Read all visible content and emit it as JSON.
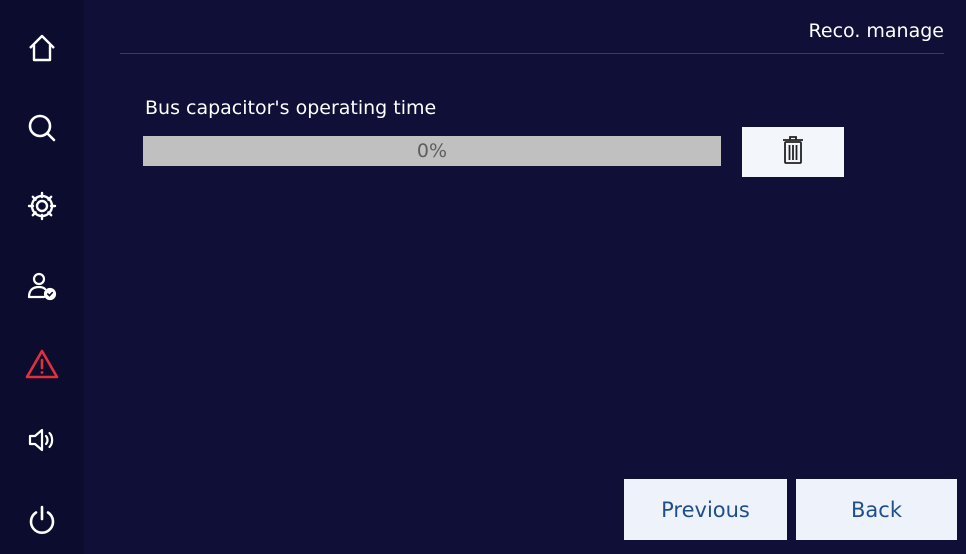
{
  "header": {
    "title": "Reco. manage"
  },
  "sidebar": {
    "items": [
      {
        "icon": "home-icon"
      },
      {
        "icon": "search-icon"
      },
      {
        "icon": "gear-icon"
      },
      {
        "icon": "user-check-icon"
      },
      {
        "icon": "warning-icon",
        "color": "#e0303c"
      },
      {
        "icon": "speaker-icon"
      },
      {
        "icon": "power-icon"
      }
    ]
  },
  "main": {
    "parameter": {
      "label": "Bus capacitor's operating time",
      "progress_text": "0%",
      "progress_value": 0,
      "delete_icon": "trash-icon"
    }
  },
  "footer": {
    "previous_label": "Previous",
    "back_label": "Back"
  },
  "colors": {
    "background": "#0f0f37",
    "accent": "#1f4f8a",
    "alert": "#e0303c"
  }
}
